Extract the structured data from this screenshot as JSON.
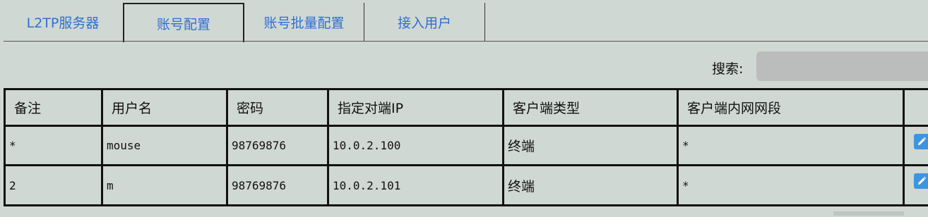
{
  "tabs": [
    {
      "label": "L2TP服务器",
      "active": false
    },
    {
      "label": "账号配置",
      "active": true
    },
    {
      "label": "账号批量配置",
      "active": false
    },
    {
      "label": "接入用户",
      "active": false
    }
  ],
  "search": {
    "label": "搜索:",
    "value": "",
    "placeholder": ""
  },
  "table": {
    "headers": [
      "备注",
      "用户名",
      "密码",
      "指定对端IP",
      "客户端类型",
      "客户端内网网段",
      ""
    ],
    "rows": [
      [
        "*",
        "mouse",
        "98769876",
        "10.0.2.100",
        "终端",
        "*"
      ],
      [
        "2",
        "m",
        "98769876",
        "10.0.2.101",
        "终端",
        "*"
      ]
    ],
    "row_action_icon": "edit-icon"
  },
  "colors": {
    "background": "#d0d8d3",
    "tab_text": "#2f6fd1",
    "search_field": "#bbbcbc",
    "edit_button": "#3d94e0"
  }
}
